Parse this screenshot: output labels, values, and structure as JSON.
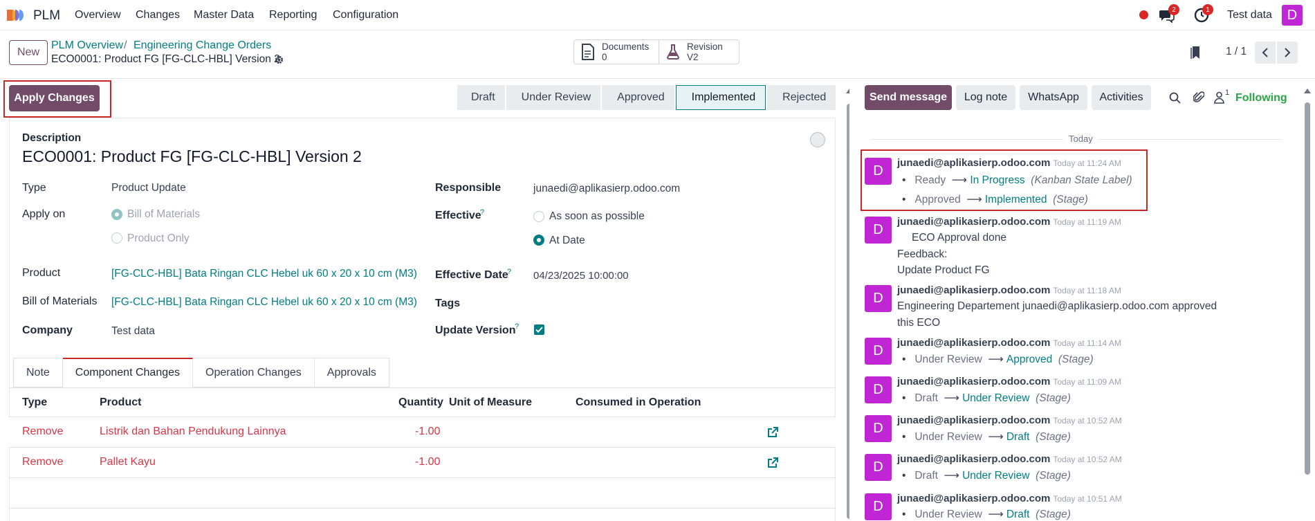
{
  "topnav": {
    "app_name": "PLM",
    "menu": [
      "Overview",
      "Changes",
      "Master Data",
      "Reporting",
      "Configuration"
    ],
    "chat_badge": "2",
    "activity_badge": "1",
    "company": "Test data",
    "user_initial": "D"
  },
  "control": {
    "new_label": "New",
    "breadcrumb": [
      "PLM Overview",
      "Engineering Change Orders"
    ],
    "breadcrumb_sep": "/",
    "record_title": "ECO0001: Product FG [FG-CLC-HBL] Version 2",
    "documents_label": "Documents",
    "documents_count": "0",
    "revision_label": "Revision",
    "revision_value": "V2",
    "pager": "1 / 1"
  },
  "statusbar": {
    "apply_label": "Apply Changes",
    "stages": [
      "Draft",
      "Under Review",
      "Approved",
      "Implemented",
      "Rejected"
    ],
    "active_stage": "Implemented"
  },
  "form": {
    "description_label": "Description",
    "description": "ECO0001: Product FG [FG-CLC-HBL] Version 2",
    "type_label": "Type",
    "type_value": "Product Update",
    "apply_on_label": "Apply on",
    "apply_on_options": [
      "Bill of Materials",
      "Product Only"
    ],
    "product_label": "Product",
    "product_value": "[FG-CLC-HBL] Bata Ringan CLC Hebel uk 60 x 20 x 10 cm (M3)",
    "bom_label": "Bill of Materials",
    "bom_value": "[FG-CLC-HBL] Bata Ringan CLC Hebel uk 60 x 20 x 10 cm (M3)",
    "company_label": "Company",
    "company_value": "Test data",
    "responsible_label": "Responsible",
    "responsible_value": "junaedi@aplikasierp.odoo.com",
    "effective_label": "Effective",
    "effective_options": [
      "As soon as possible",
      "At Date"
    ],
    "effective_date_label": "Effective Date",
    "effective_date_value": "04/23/2025 10:00:00",
    "tags_label": "Tags",
    "update_version_label": "Update Version",
    "help_mark": "?"
  },
  "tabs": [
    "Note",
    "Component Changes",
    "Operation Changes",
    "Approvals"
  ],
  "table": {
    "headers": [
      "Type",
      "Product",
      "Quantity",
      "Unit of Measure",
      "Consumed in Operation"
    ],
    "rows": [
      {
        "type": "Remove",
        "product": "Listrik dan Bahan Pendukung Lainnya",
        "quantity": "-1.00"
      },
      {
        "type": "Remove",
        "product": "Pallet Kayu",
        "quantity": "-1.00"
      }
    ]
  },
  "chatter": {
    "send_message": "Send message",
    "log_note": "Log note",
    "whatsapp": "WhatsApp",
    "activities": "Activities",
    "followers_count": "1",
    "following": "Following",
    "day_label": "Today",
    "messages": [
      {
        "author": "junaedi@aplikasierp.odoo.com",
        "time": "Today at 11:24 AM",
        "tracks": [
          {
            "old": "Ready",
            "new": "In Progress",
            "field": "(Kanban State Label)"
          },
          {
            "old": "Approved",
            "new": "Implemented",
            "field": "(Stage)"
          }
        ]
      },
      {
        "author": "junaedi@aplikasierp.odoo.com",
        "time": "Today at 11:19 AM",
        "lines": [
          "ECO Approval done",
          "Feedback:",
          "Update Product FG"
        ]
      },
      {
        "author": "junaedi@aplikasierp.odoo.com",
        "time": "Today at 11:18 AM",
        "lines": [
          "Engineering Departement junaedi@aplikasierp.odoo.com approved",
          "this ECO"
        ]
      },
      {
        "author": "junaedi@aplikasierp.odoo.com",
        "time": "Today at 11:14 AM",
        "tracks": [
          {
            "old": "Under Review",
            "new": "Approved",
            "field": "(Stage)"
          }
        ]
      },
      {
        "author": "junaedi@aplikasierp.odoo.com",
        "time": "Today at 11:09 AM",
        "tracks": [
          {
            "old": "Draft",
            "new": "Under Review",
            "field": "(Stage)"
          }
        ]
      },
      {
        "author": "junaedi@aplikasierp.odoo.com",
        "time": "Today at 10:52 AM",
        "tracks": [
          {
            "old": "Under Review",
            "new": "Draft",
            "field": "(Stage)"
          }
        ]
      },
      {
        "author": "junaedi@aplikasierp.odoo.com",
        "time": "Today at 10:52 AM",
        "tracks": [
          {
            "old": "Draft",
            "new": "Under Review",
            "field": "(Stage)"
          }
        ]
      },
      {
        "author": "junaedi@aplikasierp.odoo.com",
        "time": "Today at 10:51 AM",
        "tracks": [
          {
            "old": "Under Review",
            "new": "Draft",
            "field": "(Stage)"
          }
        ]
      }
    ]
  },
  "colors": {
    "brand": "#714b67",
    "link": "#017e84",
    "danger": "#dc3545",
    "avatar": "#c026d3",
    "highlight": "#c62828"
  }
}
